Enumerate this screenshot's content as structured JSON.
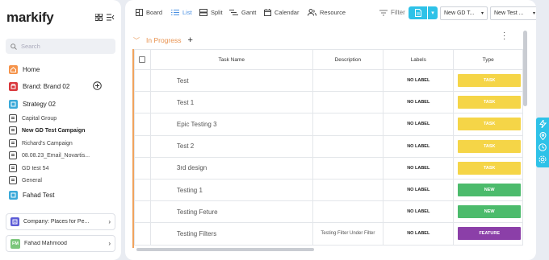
{
  "app": {
    "logo": "markify"
  },
  "sidebar": {
    "search_placeholder": "Search",
    "items": [
      {
        "label": "Home",
        "icon": "home-icon",
        "color": "#f5934a"
      },
      {
        "label": "Brand: Brand 02",
        "icon": "brand-icon",
        "color": "#d9373c"
      },
      {
        "label": "Strategy 02",
        "icon": "strategy-icon",
        "color": "#3aa9d9"
      }
    ],
    "subitems": [
      {
        "label": "Capital Group",
        "active": false
      },
      {
        "label": "New GD Test Campaign",
        "active": true
      },
      {
        "label": "Richard's Campaign",
        "active": false
      },
      {
        "label": "08.08.23_Email_Novartis...",
        "active": false
      },
      {
        "label": "GD test 54",
        "active": false
      },
      {
        "label": "General",
        "active": false
      }
    ],
    "fahad_test": {
      "label": "Fahad Test",
      "color": "#3aa9d9"
    },
    "company_card": {
      "label": "Company: Places for Pe...",
      "color": "#5b5bd6"
    },
    "user_card": {
      "initials": "FM",
      "label": "Fahad Mahmood",
      "color": "#7bc67b"
    }
  },
  "toolbar": {
    "views": [
      {
        "label": "Board",
        "icon": "board-icon"
      },
      {
        "label": "List",
        "icon": "list-icon",
        "active": true
      },
      {
        "label": "Split",
        "icon": "split-icon"
      },
      {
        "label": "Gantt",
        "icon": "gantt-icon"
      },
      {
        "label": "Calendar",
        "icon": "calendar-icon"
      },
      {
        "label": "Resource",
        "icon": "resource-icon"
      }
    ],
    "filter_label": "Filter",
    "select_1": "New GD T...",
    "select_2": "New Test ..."
  },
  "group": {
    "name": "In Progress"
  },
  "table": {
    "headers": {
      "name": "Task Name",
      "description": "Description",
      "labels": "Labels",
      "type": "Type"
    },
    "rows": [
      {
        "name": "Test",
        "description": "",
        "label": "NO LABEL",
        "type": "TASK",
        "type_color": "#f5d547"
      },
      {
        "name": "Test 1",
        "description": "",
        "label": "NO LABEL",
        "type": "TASK",
        "type_color": "#f5d547"
      },
      {
        "name": "Epic Testing 3",
        "description": "",
        "label": "NO LABEL",
        "type": "TASK",
        "type_color": "#f5d547"
      },
      {
        "name": "Test 2",
        "description": "",
        "label": "NO LABEL",
        "type": "TASK",
        "type_color": "#f5d547"
      },
      {
        "name": "3rd design",
        "description": "",
        "label": "NO LABEL",
        "type": "TASK",
        "type_color": "#f5d547"
      },
      {
        "name": "Testing 1",
        "description": "",
        "label": "NO LABEL",
        "type": "NEW",
        "type_color": "#4cbb6c"
      },
      {
        "name": "Testing Feture",
        "description": "",
        "label": "NO LABEL",
        "type": "NEW",
        "type_color": "#4cbb6c"
      },
      {
        "name": "Testing Filters",
        "description": "Testing Filter Under Filter",
        "label": "NO LABEL",
        "type": "FEATURE",
        "type_color": "#8b3fa8"
      }
    ]
  },
  "right_bar": {
    "icons": [
      "bolt-icon",
      "location-icon",
      "clock-icon",
      "gear-icon"
    ]
  }
}
